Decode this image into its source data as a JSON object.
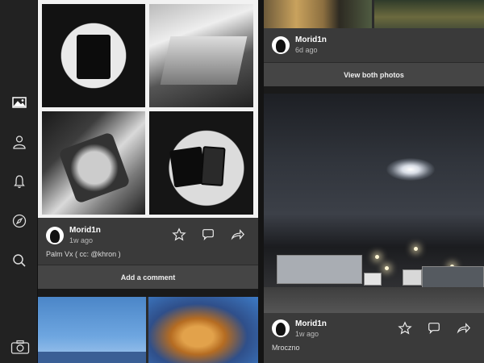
{
  "sidebar": {
    "items": [
      {
        "icon": "photos-icon"
      },
      {
        "icon": "profile-icon"
      },
      {
        "icon": "notifications-icon"
      },
      {
        "icon": "explore-icon"
      },
      {
        "icon": "search-icon"
      }
    ],
    "camera_icon": "camera-icon"
  },
  "feed": {
    "post1": {
      "username": "Morid1n",
      "time": "1w ago",
      "caption": "Palm Vx ( cc: @khron )",
      "comment_button": "Add a comment"
    },
    "post2": {
      "username": "Morid1n",
      "time": "6d ago",
      "view_button": "View both photos"
    },
    "post3": {
      "username": "Morid1n",
      "time": "1w ago",
      "caption": "Mroczno"
    }
  },
  "colors": {
    "sidebar_bg": "#222222",
    "panel_bg": "#3a3a3a",
    "accent_text": "#ffffff"
  }
}
